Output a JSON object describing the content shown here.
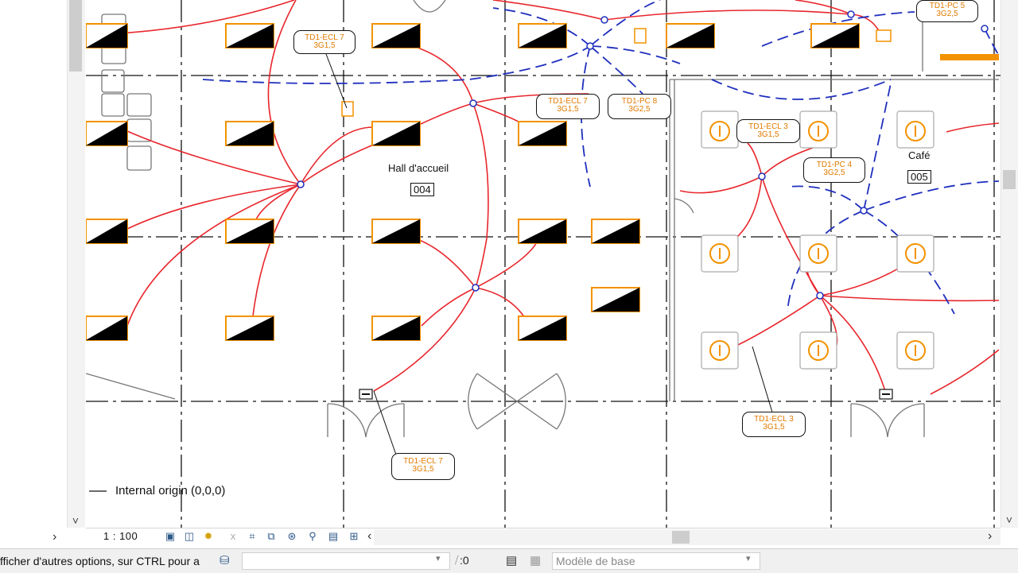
{
  "drawing": {
    "rooms": [
      {
        "name": "Hall d'accueil",
        "number": "004"
      },
      {
        "name": "Café",
        "number": "005"
      }
    ],
    "tags": [
      {
        "line1": "TD1-ECL 7",
        "line2": "3G1,5"
      },
      {
        "line1": "TD1-ECL 7",
        "line2": "3G1,5"
      },
      {
        "line1": "TD1-PC 8",
        "line2": "3G2,5"
      },
      {
        "line1": "TD1-ECL 3",
        "line2": "3G1,5"
      },
      {
        "line1": "TD1-PC 4",
        "line2": "3G2,5"
      },
      {
        "line1": "TD1-PC 5",
        "line2": "3G2,5"
      },
      {
        "line1": "TD1-ECL 3",
        "line2": "3G1,5"
      },
      {
        "line1": "TD1-ECL 7",
        "line2": "3G1,5"
      }
    ],
    "origin_label": "Internal origin (0,0,0)",
    "colors": {
      "circuit_lighting": "#e8262c",
      "circuit_power": "#1f2fbd",
      "fixture": "#f39200",
      "grid": "#111111"
    }
  },
  "view_bar": {
    "scale": "1 : 100",
    "icons": [
      "detail-level-icon",
      "visual-style-icon",
      "sun-path-icon",
      "shadows-icon",
      "crop-view-icon",
      "show-crop-icon",
      "temporary-hide-icon",
      "reveal-hidden-icon",
      "highlight-icon",
      "analytical-model-icon",
      "constraints-icon"
    ]
  },
  "status_bar": {
    "hint": "fficher d'autres options, sur CTRL pour a",
    "selection_count": ":0",
    "model": "Modèle de base"
  }
}
